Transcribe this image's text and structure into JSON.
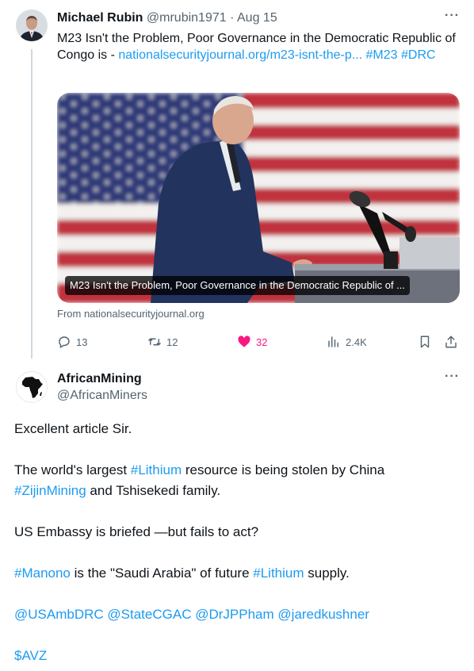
{
  "tweet1": {
    "name": "Michael Rubin",
    "handle": "@mrubin1971",
    "date": "· Aug 15",
    "more": "···",
    "text": "M23 Isn't the Problem, Poor Governance in the Democratic Republic of Congo is -",
    "link": "nationalsecurityjournal.org/m23-isnt-the-p...",
    "tag1": "#M23",
    "tag2": "#DRC",
    "card_caption": "M23 Isn't the Problem, Poor Governance in the Democratic Republic of ...",
    "card_source": "From nationalsecurityjournal.org",
    "replies": "13",
    "retweets": "12",
    "likes": "32",
    "views": "2.4K"
  },
  "tweet2": {
    "name": "AfricanMining",
    "handle": "@AfricanMiners",
    "more": "···",
    "p1": "Excellent article Sir.",
    "p2_a": "The world's largest ",
    "p2_tag1": "#Lithium",
    "p2_b": " resource is being stolen by China ",
    "p2_tag2": "#ZijinMining",
    "p2_c": " and Tshisekedi family.",
    "p3": "US Embassy is briefed —but fails to act?",
    "p4_tag1": "#Manono",
    "p4_a": " is the \"Saudi Arabia\" of future ",
    "p4_tag2": "#Lithium",
    "p4_b": " supply.",
    "p5_m1": "@USAmbDRC",
    "p5_m2": "@StateCGAC",
    "p5_m3": "@DrJPPham",
    "p5_m4": "@jaredkushner",
    "p6_cash": "$AVZ"
  },
  "colors": {
    "link": "#1d9bf0",
    "like": "#f91880",
    "muted": "#536471"
  }
}
